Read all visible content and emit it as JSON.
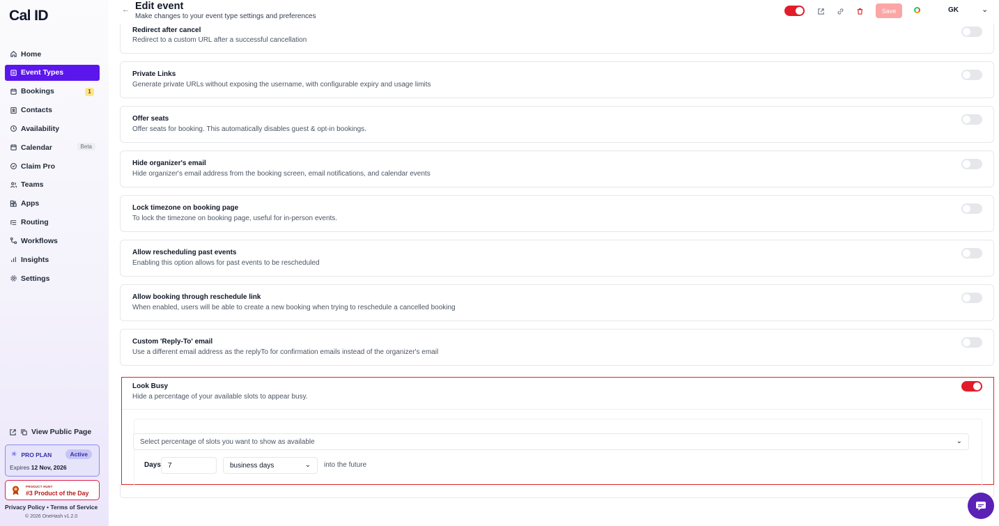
{
  "app": {
    "logo": "Cal ID"
  },
  "sidebar": {
    "items": [
      {
        "label": "Home",
        "icon": "home-icon"
      },
      {
        "label": "Event Types",
        "icon": "event-types-icon",
        "active": true
      },
      {
        "label": "Bookings",
        "icon": "calendar-icon",
        "badge": "1"
      },
      {
        "label": "Contacts",
        "icon": "contacts-icon"
      },
      {
        "label": "Availability",
        "icon": "clock-icon"
      },
      {
        "label": "Calendar",
        "icon": "calendar-icon",
        "tag": "Beta"
      },
      {
        "label": "Claim Pro",
        "icon": "claim-icon"
      },
      {
        "label": "Teams",
        "icon": "users-icon"
      },
      {
        "label": "Apps",
        "icon": "apps-icon"
      },
      {
        "label": "Routing",
        "icon": "routing-icon"
      },
      {
        "label": "Workflows",
        "icon": "workflow-icon"
      },
      {
        "label": "Insights",
        "icon": "bar-chart-icon"
      },
      {
        "label": "Settings",
        "icon": "gear-icon"
      }
    ],
    "public_page": "View Public Page",
    "plan": {
      "name": "PRO PLAN",
      "status": "Active",
      "expires_label": "Expires",
      "expires_date": "12 Nov, 2026"
    },
    "product_hunt": {
      "small": "PRODUCT HUNT",
      "text": "#3 Product of the Day"
    },
    "legal": "Privacy Policy • Terms of Service",
    "copyright": "© 2026 OneHash v1.2.0"
  },
  "header": {
    "title": "Edit event",
    "subtitle": "Make changes to your event type settings and preferences",
    "save_label": "Save",
    "user_initials": "GK"
  },
  "settings": [
    {
      "title": "Redirect after cancel",
      "description": "Redirect to a custom URL after a successful cancellation",
      "enabled": false
    },
    {
      "title": "Private Links",
      "description": "Generate private URLs without exposing the username, with configurable expiry and usage limits",
      "enabled": false
    },
    {
      "title": "Offer seats",
      "description": "Offer seats for booking. This automatically disables guest & opt-in bookings.",
      "enabled": false
    },
    {
      "title": "Hide organizer's email",
      "description": "Hide organizer's email address from the booking screen, email notifications, and calendar events",
      "enabled": false
    },
    {
      "title": "Lock timezone on booking page",
      "description": "To lock the timezone on booking page, useful for in-person events.",
      "enabled": false
    },
    {
      "title": "Allow rescheduling past events",
      "description": "Enabling this option allows for past events to be rescheduled",
      "enabled": false
    },
    {
      "title": "Allow booking through reschedule link",
      "description": "When enabled, users will be able to create a new booking when trying to reschedule a cancelled booking",
      "enabled": false
    },
    {
      "title": "Custom 'Reply-To' email",
      "description": "Use a different email address as the replyTo for confirmation emails instead of the organizer's email",
      "enabled": false
    }
  ],
  "look_busy": {
    "title": "Look Busy",
    "description": "Hide a percentage of your available slots to appear busy.",
    "enabled": true,
    "percentage_placeholder": "Select percentage of slots you want to show as available",
    "days_label": "Days",
    "days_value": "7",
    "days_type": "business days",
    "days_suffix": "into the future"
  },
  "colors": {
    "accent": "#5b16ee",
    "danger": "#e11d2a"
  }
}
